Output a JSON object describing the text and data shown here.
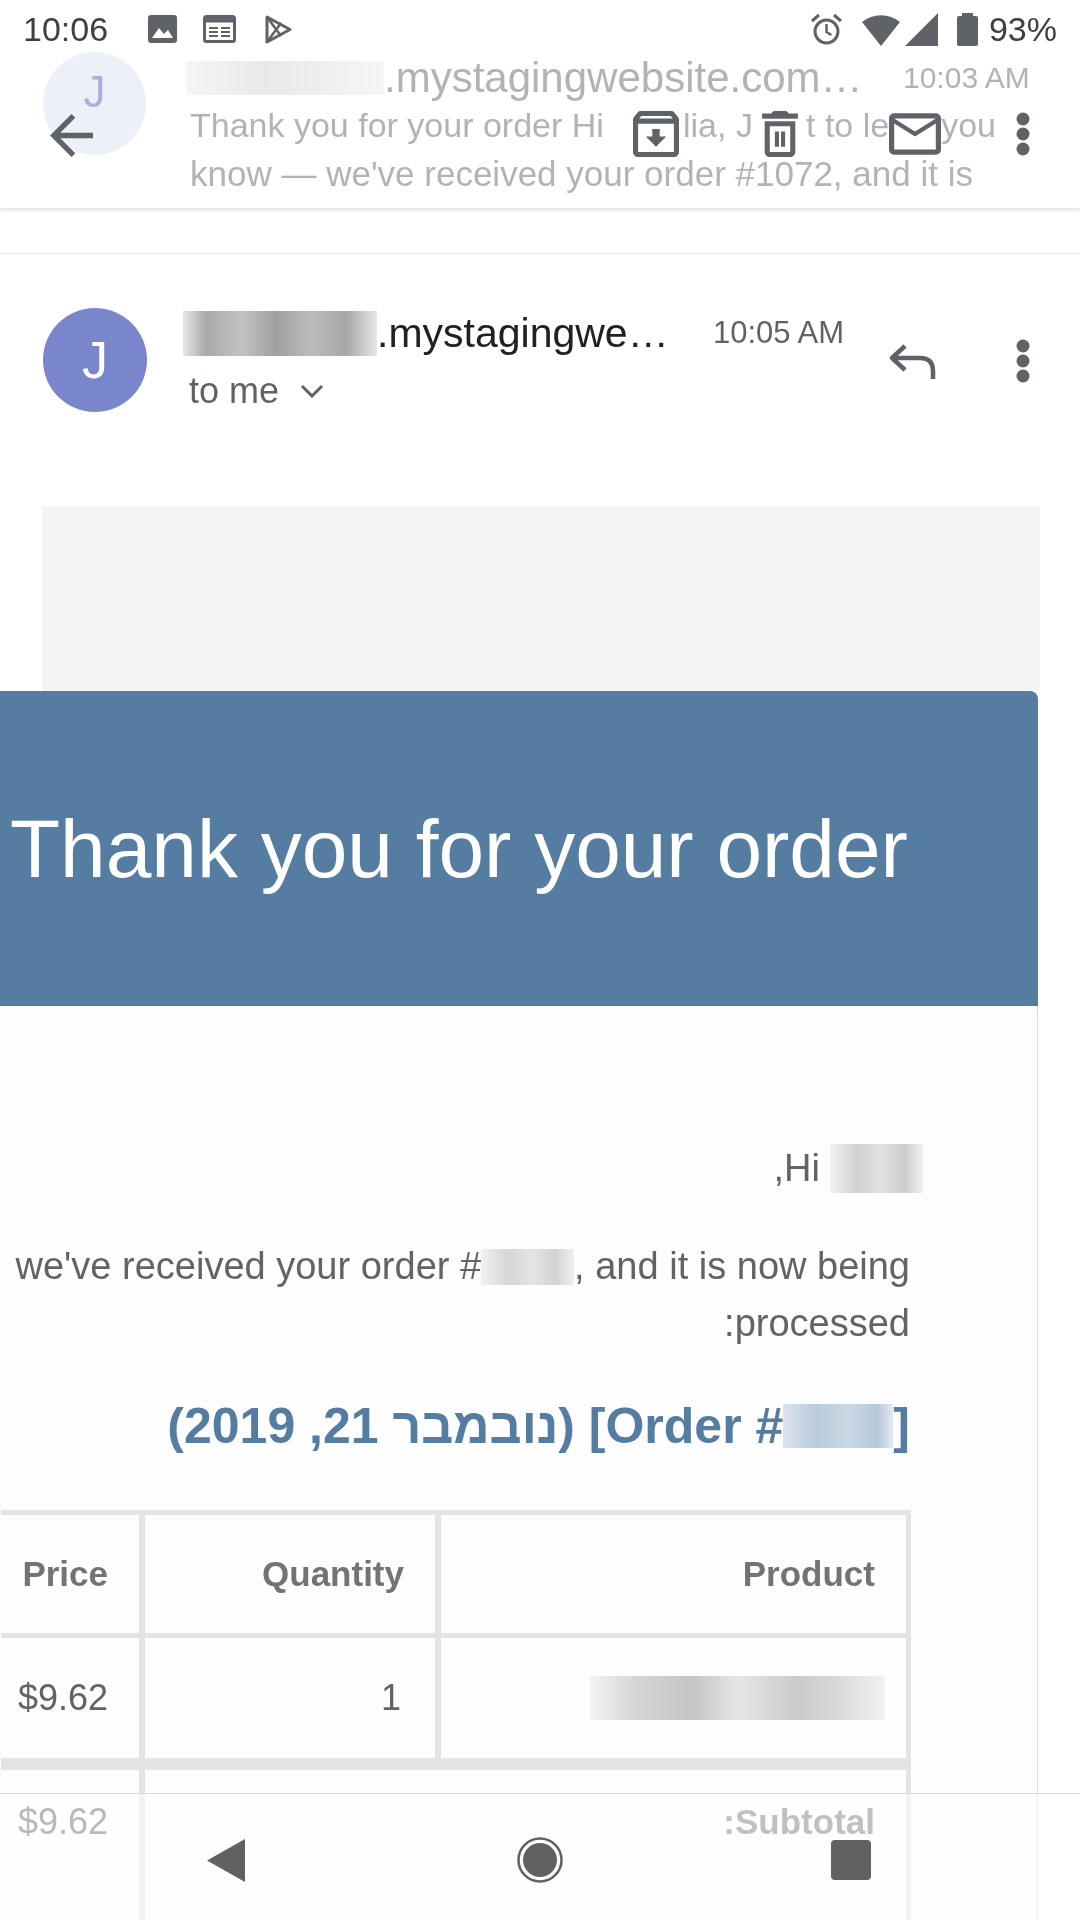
{
  "status_bar": {
    "time": "10:06",
    "battery_percent": "93%"
  },
  "background_message": {
    "avatar_letter": "J",
    "sender": ".mystagingwebsite.com…",
    "time": "10:03 AM",
    "preview_line_1_fragments": [
      "Thank you for your order Hi",
      "lia, J",
      "t to le",
      "you"
    ],
    "preview_line_2": "know — we've received your order #1072, and it is"
  },
  "message_header": {
    "avatar_letter": "J",
    "sender": ".mystagingwe…",
    "time": "10:05 AM",
    "recipient": "to me"
  },
  "email": {
    "banner_title": "Thank you for your order",
    "greeting": ",Hi",
    "body_line_1_start": "we've received your order #",
    "body_line_1_end": ", and it is now being",
    "body_line_2": ":processed",
    "order_heading_start": "(2019 ,21 נובמבר) [Order #",
    "order_heading_end": "]",
    "table": {
      "columns": [
        "Price",
        "Quantity",
        "Product"
      ],
      "rows": [
        {
          "price": "$9.62",
          "quantity": "1"
        }
      ],
      "footer": {
        "price": "$9.62",
        "label": ":Subtotal"
      }
    }
  }
}
